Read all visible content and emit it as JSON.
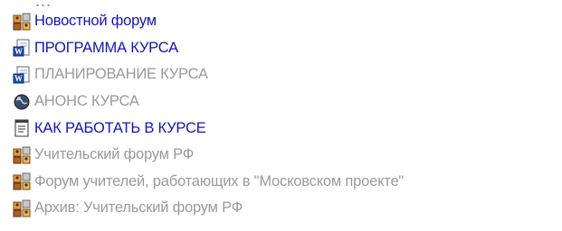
{
  "header_fragment": "…",
  "items": [
    {
      "label": "Новостной форум",
      "icon": "forum-icon",
      "state": "active"
    },
    {
      "label": "ПРОГРАММА КУРСА",
      "icon": "word-document-icon",
      "state": "active"
    },
    {
      "label": "ПЛАНИРОВАНИЕ КУРСА",
      "icon": "word-document-icon",
      "state": "dim"
    },
    {
      "label": "АНОНС КУРСА",
      "icon": "globe-link-icon",
      "state": "dim"
    },
    {
      "label": "КАК РАБОТАТЬ В КУРСЕ",
      "icon": "text-page-icon",
      "state": "active"
    },
    {
      "label": "Учительский форум РФ",
      "icon": "forum-icon",
      "state": "dim"
    },
    {
      "label": "Форум учителей, работающих в \"Московском проекте\"",
      "icon": "forum-icon",
      "state": "dim"
    },
    {
      "label": "Архив: Учительский форум РФ",
      "icon": "forum-icon",
      "state": "dim"
    }
  ],
  "colors": {
    "active_link": "#1414b8",
    "dimmed_link": "#9a9a9a"
  }
}
